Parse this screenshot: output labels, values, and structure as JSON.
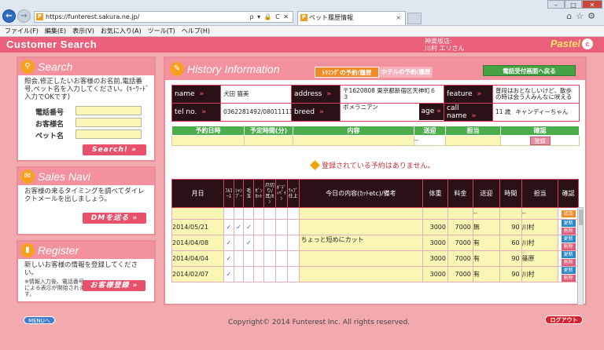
{
  "browser": {
    "url": "https://funterest.sakura.ne.jp/",
    "url_tools": "ρ ▾ 🔒 C ✕",
    "tab_title": "ペット履歴情報",
    "menu": [
      "ファイル(F)",
      "編集(E)",
      "表示(V)",
      "お気に入り(A)",
      "ツール(T)",
      "ヘルプ(H)"
    ]
  },
  "header": {
    "title": "Customer Search",
    "user_line1": "神楽坂店:",
    "user_line2": "川村 エリさん",
    "logo": "Pastel"
  },
  "search": {
    "title": "Search",
    "desc": "照会,修正したいお客様のお名前,電話番号,ペット名を入力してください。(ｷｰﾜｰﾄﾞ入力でOKです)",
    "fields": [
      {
        "label": "電話番号",
        "value": ""
      },
      {
        "label": "お客様名",
        "value": ""
      },
      {
        "label": "ペット名",
        "value": ""
      }
    ],
    "button": "Search! »"
  },
  "navi": {
    "title": "Sales Navi",
    "desc": "お客様の来るタイミングを調べてダイレクトメールを出しましょう。",
    "button": "DMを送る »"
  },
  "register": {
    "title": "Register",
    "desc": "新しいお客様の情報を登録してください。",
    "note": "※情報入力後、電話番号による表示が開始されます。",
    "button": "お客様登録 »"
  },
  "history": {
    "title": "History Information",
    "btn_reserve": "ﾄﾘﾐﾝｸﾞの予約/履歴",
    "btn_hotel": "ホテルの予約/履歴",
    "btn_back": "電話受付画面へ戻る"
  },
  "customer": {
    "name_label": "name",
    "name": "犬田 猫美",
    "address_label": "address",
    "address": "〒1620808 東京都新宿区天神町６３",
    "feature_label": "feature",
    "feature": "普段はおとなしいけど、散歩の時は会う人みんなに吠える",
    "tel_label": "tel no.",
    "tel": "0362281492/08011111111",
    "breed_label": "breed",
    "breed": "ポメラニアン",
    "age_label": "age",
    "age": "11 歳",
    "callname_label": "call name",
    "callname": "キャンディーちゃん"
  },
  "reservation": {
    "headers": [
      "予約日時",
      "予定時間(分)",
      "内容",
      "送迎",
      "担当",
      "確認"
    ],
    "pickup_value": "--",
    "register_button": "登録"
  },
  "no_reservation_msg": "登録されている予約はありません。",
  "records": {
    "headers": [
      "月日",
      "ﾌﾙｺｰｽ",
      "ｼｬﾝﾌﾟｰ",
      "毛玉",
      "ｾﾞﾝｶｯﾄ",
      "爪切り/耳/ｶﾝ",
      "ﾎﾞﾃﾞｨﾍﾟｲﾝ",
      "ﾗｯﾌﾟ仕上",
      "今日の内容(ｶｯﾄetc)/備考",
      "体重",
      "料金",
      "送迎",
      "時間",
      "担当",
      "確認"
    ],
    "new_row": {
      "pickup": "--",
      "staff": "--",
      "action": "追加"
    },
    "update_label": "更新",
    "delete_label": "削除",
    "rows": [
      {
        "date": "2014/05/21",
        "checks": [
          true,
          true,
          true,
          false,
          false,
          false,
          false
        ],
        "comment": "",
        "weight": "3000",
        "fee": "7000",
        "pickup": "無",
        "time": "90",
        "staff": "川村"
      },
      {
        "date": "2014/04/08",
        "checks": [
          true,
          false,
          true,
          false,
          false,
          false,
          false
        ],
        "comment": "ちょっと短めにカット",
        "weight": "3000",
        "fee": "7000",
        "pickup": "有",
        "time": "60",
        "staff": "川村"
      },
      {
        "date": "2014/04/04",
        "checks": [
          true,
          false,
          false,
          false,
          false,
          false,
          false
        ],
        "comment": "",
        "weight": "3000",
        "fee": "7000",
        "pickup": "有",
        "time": "90",
        "staff": "篠原"
      },
      {
        "date": "2014/02/07",
        "checks": [
          true,
          false,
          false,
          false,
          false,
          false,
          false
        ],
        "comment": "",
        "weight": "3000",
        "fee": "7000",
        "pickup": "有",
        "time": "90",
        "staff": "川村"
      }
    ]
  },
  "footer": {
    "menu_button": "MENUへ",
    "copyright": "Copyright© 2014 Funterest Inc. All rights reserved.",
    "logout_button": "ログアウト"
  },
  "colors": {
    "accent": "#ea5f79",
    "green": "#4cad4d",
    "input": "#faf7b6"
  }
}
